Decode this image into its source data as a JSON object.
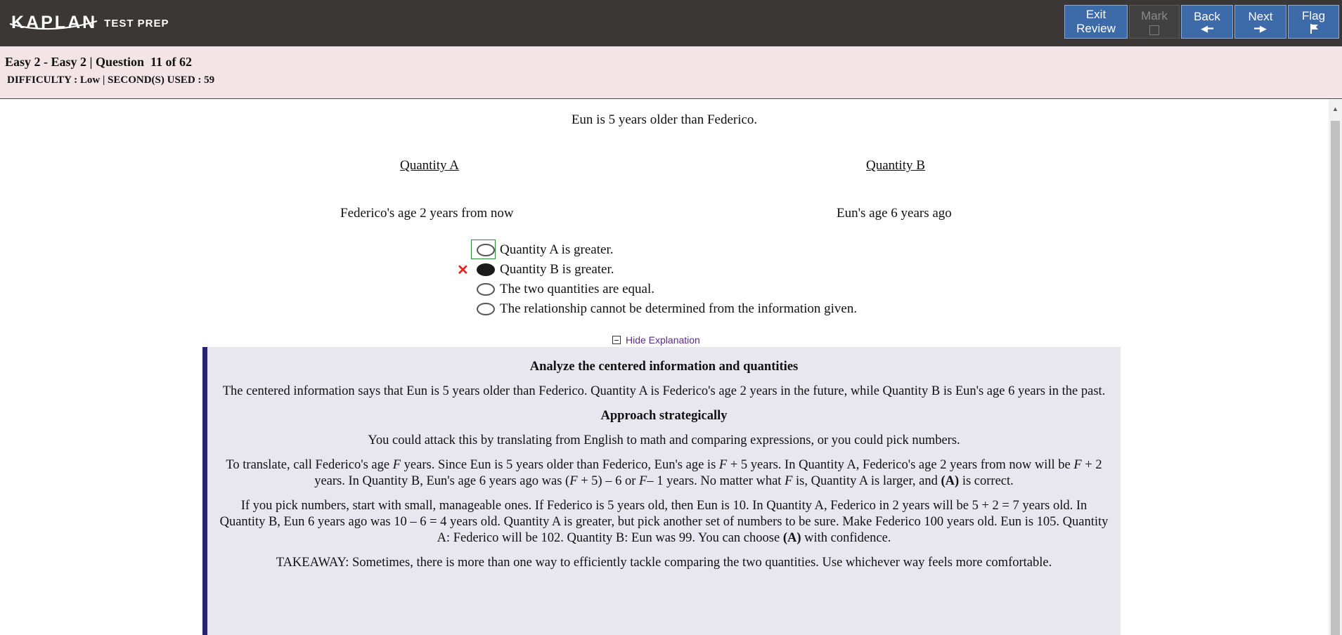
{
  "brand": {
    "logo": "KAPLAN",
    "sub": "TEST PREP"
  },
  "nav": {
    "exit_line1": "Exit",
    "exit_line2": "Review",
    "mark": "Mark",
    "back": "Back",
    "next": "Next",
    "flag": "Flag"
  },
  "header": {
    "title": "Easy 2 - Easy 2 | Question  11 of 62",
    "meta": "DIFFICULTY : Low | SECOND(S) USED : 59"
  },
  "question": {
    "stem": "Eun is 5 years older than Federico.",
    "quantity_a_label": "Quantity A",
    "quantity_b_label": "Quantity B",
    "quantity_a_value": "Federico's age 2 years from now",
    "quantity_b_value": "Eun's age 6 years ago",
    "choices": [
      {
        "text": "Quantity A is greater.",
        "selected": false,
        "correct": true
      },
      {
        "text": "Quantity B is greater.",
        "selected": true,
        "correct": false
      },
      {
        "text": "The two quantities are equal.",
        "selected": false,
        "correct": false
      },
      {
        "text": "The relationship cannot be determined from the information given.",
        "selected": false,
        "correct": false
      }
    ]
  },
  "toggle_label": "Hide Explanation",
  "explanation": {
    "h1": "Analyze the centered information and quantities",
    "p1": "The centered information says that Eun is 5 years older than Federico. Quantity A is Federico's age 2 years in the future, while Quantity B is Eun's age 6 years in the past.",
    "h2": "Approach strategically",
    "p2": "You could attack this by translating from English to math and comparing expressions, or you could pick numbers.",
    "p3": {
      "s1": "To translate, call Federico's age ",
      "F": "F",
      "s2": " years. Since Eun is 5 years older than Federico, Eun's age is ",
      "s3": " + 5 years. In Quantity A, Federico's age 2 years from now will be ",
      "s4": " + 2 years. In Quantity B, Eun's age 6 years ago was (",
      "s5": " + 5) – 6 or ",
      "s6": "– 1 years. No matter what ",
      "s7": " is, Quantity A is larger, and ",
      "bold": "(A)",
      "s8": " is correct."
    },
    "p4": {
      "s1": "If you pick numbers, start with small, manageable ones. If Federico is 5 years old, then Eun is 10. In Quantity A, Federico in 2 years will be 5 + 2 = 7 years old. In Quantity B, Eun 6 years ago was 10 – 6 = 4 years old. Quantity A is greater, but pick another set of numbers to be sure. Make Federico 100 years old. Eun is 105. Quantity A: Federico will be 102. Quantity B: Eun was 99. You can choose ",
      "bold": "(A)",
      "s2": " with confidence."
    },
    "p5": "TAKEAWAY: Sometimes, there is more than one way to efficiently tackle comparing the two quantities. Use whichever way feels more comfortable."
  }
}
